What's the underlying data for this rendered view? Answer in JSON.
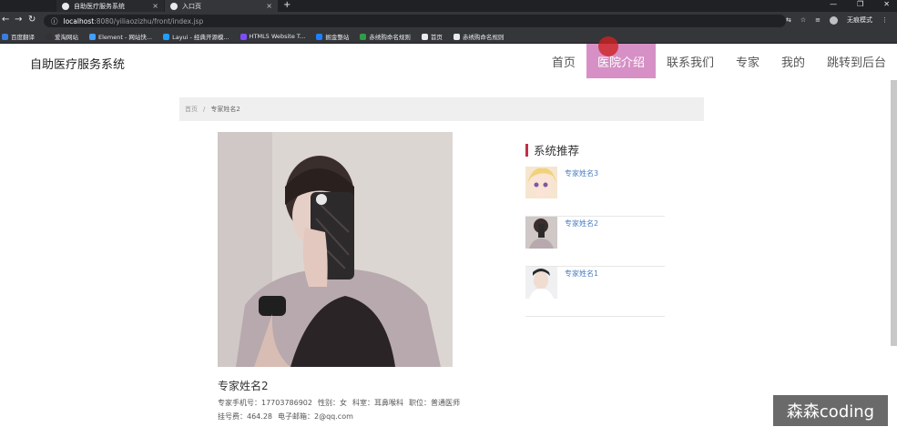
{
  "browser": {
    "tabs": [
      {
        "label": "自助医疗服务系统"
      },
      {
        "label": "入口页"
      }
    ],
    "new_tab": "+",
    "window_controls": [
      "—",
      "❐",
      "✕"
    ],
    "url_host": "localhost",
    "url_path": ":8080/yiliaozizhu/front/index.jsp",
    "incognito_label": "无痕模式",
    "bookmarks": [
      {
        "label": "百度翻译",
        "color": "#3b7ddd"
      },
      {
        "label": "爱淘网站",
        "color": "#333333"
      },
      {
        "label": "Element - 网站快...",
        "color": "#409eff"
      },
      {
        "label": "Layui - 经典开源模...",
        "color": "#1e9fff"
      },
      {
        "label": "HTML5 Website T...",
        "color": "#7c4dff"
      },
      {
        "label": "掘金整站",
        "color": "#1e80ff"
      },
      {
        "label": "赤绣购命名规则",
        "color": "#2e9e44"
      },
      {
        "label": "首页",
        "color": "#e8eaed"
      },
      {
        "label": "赤绣购命名规则",
        "color": "#e8eaed"
      }
    ]
  },
  "header": {
    "site_title": "自助医疗服务系统",
    "nav": [
      {
        "label": "首页"
      },
      {
        "label": "医院介绍"
      },
      {
        "label": "联系我们"
      },
      {
        "label": "专家"
      },
      {
        "label": "我的"
      },
      {
        "label": "跳转到后台"
      }
    ]
  },
  "breadcrumb": {
    "home": "首页",
    "separator": "/",
    "current": "专家姓名2"
  },
  "detail": {
    "name": "专家姓名2",
    "phone_label": "专家手机号：",
    "phone": "17703786902",
    "gender_label": "性别：",
    "gender": "女",
    "dept_label": "科室：",
    "dept": "耳鼻喉科",
    "title_label": "职位：",
    "title": "普通医师",
    "fee_label": "挂号费：",
    "fee": "464.28",
    "email_label": "电子邮箱：",
    "email": "2@qq.com"
  },
  "recommend": {
    "title": "系统推荐",
    "items": [
      {
        "name": "专家姓名3"
      },
      {
        "name": "专家姓名2"
      },
      {
        "name": "专家姓名1"
      }
    ]
  },
  "watermark": "森森coding",
  "colors": {
    "nav_active": "#d690c6",
    "accent_bar": "#c0304a",
    "link": "#4a7cc0"
  }
}
